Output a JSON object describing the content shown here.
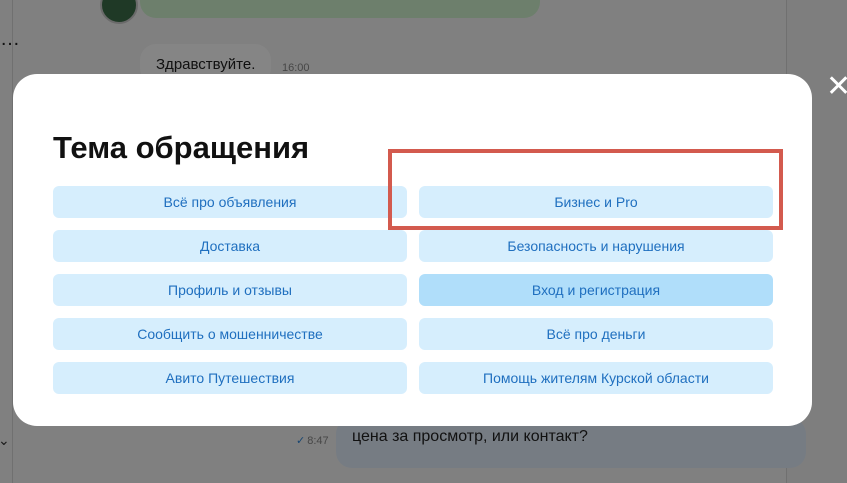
{
  "chat": {
    "incoming_message": "Здравствуйте.",
    "incoming_time": "16:00",
    "outgoing_message": "цена за просмотр, или контакт?",
    "outgoing_time": "8:47",
    "ellipsis": "…"
  },
  "modal": {
    "title": "Тема обращения",
    "close_glyph": "✕",
    "topics_left": [
      "Всё про объявления",
      "Доставка",
      "Профиль и отзывы",
      "Сообщить о мошенничестве",
      "Авито Путешествия"
    ],
    "topics_right": [
      "Бизнес и Pro",
      "Безопасность и нарушения",
      "Вход и регистрация",
      "Всё про деньги",
      "Помощь жителям Курской области"
    ],
    "highlighted_topic": "Бизнес и Pro",
    "hovered_topic": "Вход и регистрация"
  },
  "colors": {
    "button_bg": "#d6eefd",
    "button_text": "#1f6fbf",
    "highlight_border": "#d35a4e"
  }
}
